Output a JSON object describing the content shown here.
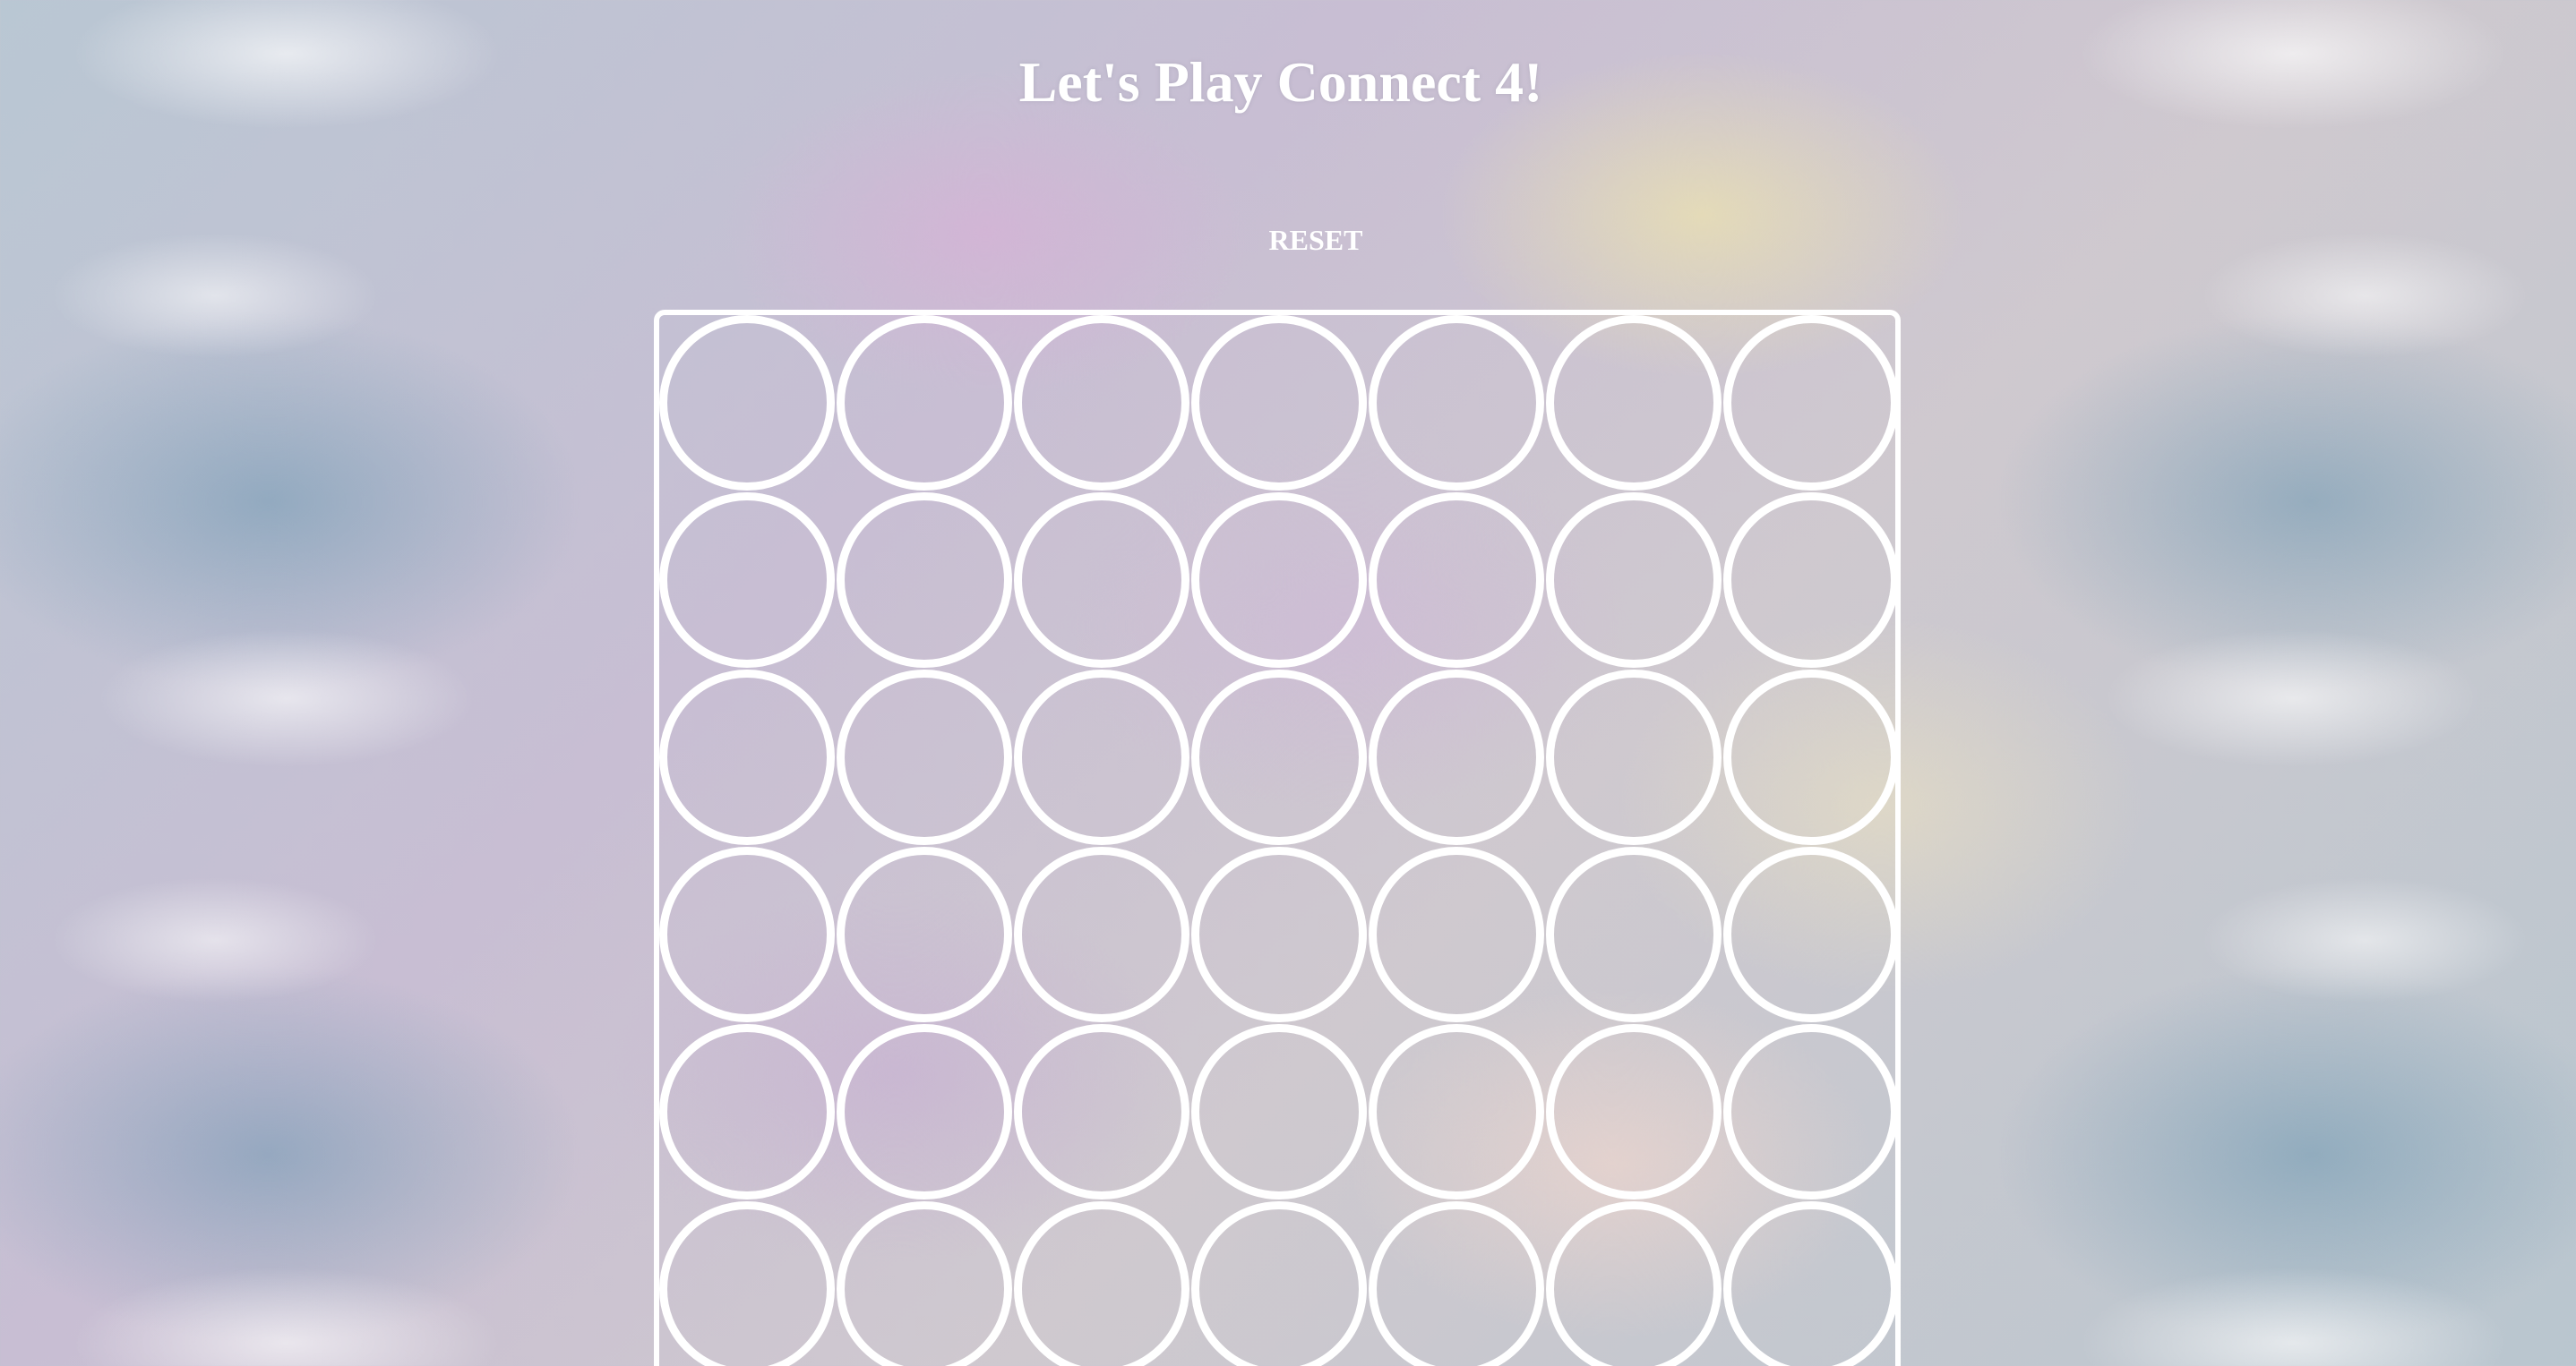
{
  "page": {
    "title": "Let's Play Connect 4!",
    "reset_label": "RESET"
  },
  "board": {
    "columns": 7,
    "rows": 6,
    "border_color": "#ffffff",
    "cells": [
      [
        "",
        "",
        "",
        "",
        "",
        "",
        ""
      ],
      [
        "",
        "",
        "",
        "",
        "",
        "",
        ""
      ],
      [
        "",
        "",
        "",
        "",
        "",
        "",
        ""
      ],
      [
        "",
        "",
        "",
        "",
        "",
        "",
        ""
      ],
      [
        "",
        "",
        "",
        "",
        "",
        "",
        ""
      ],
      [
        "",
        "",
        "",
        "",
        "",
        "",
        ""
      ]
    ]
  }
}
